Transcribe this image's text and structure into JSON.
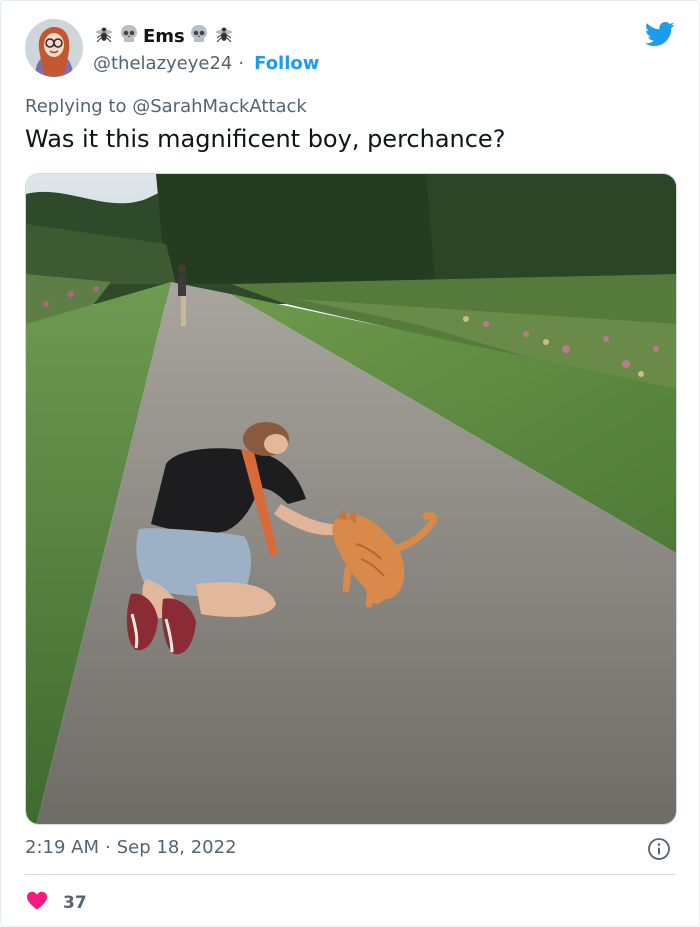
{
  "author": {
    "display_name": "Ems",
    "handle": "@thelazyeye24",
    "separator": "·",
    "follow_label": "Follow"
  },
  "reply": {
    "prefix": "Replying to",
    "mention": "@SarahMackAttack"
  },
  "tweet": {
    "text": "Was it this magnificent boy, perchance?"
  },
  "meta": {
    "time": "2:19 AM",
    "separator": "·",
    "date": "Sep 18, 2022"
  },
  "engagement": {
    "likes": "37"
  },
  "icons": {
    "brand": "twitter-bird-icon",
    "info": "info-icon",
    "like": "heart-icon",
    "name_emoji": [
      "fly-icon",
      "skull-icon",
      "skull-icon",
      "fly-icon"
    ]
  },
  "colors": {
    "brand_blue": "#1d9bf0",
    "heart": "#f91880",
    "secondary_text": "#536471",
    "primary_text": "#0f1419"
  }
}
